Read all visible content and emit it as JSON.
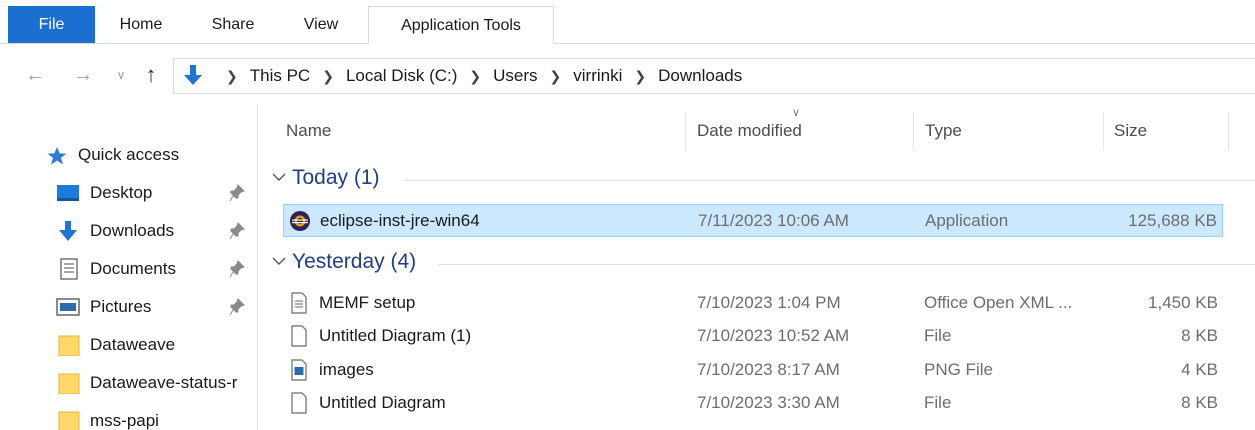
{
  "ribbon": {
    "tabs": [
      {
        "label": "File"
      },
      {
        "label": "Home"
      },
      {
        "label": "Share"
      },
      {
        "label": "View"
      },
      {
        "label": "Application Tools"
      }
    ],
    "file_tab_color": "#1a6fd0"
  },
  "address": {
    "icon": "download-arrow-icon",
    "crumbs": [
      "This PC",
      "Local Disk (C:)",
      "Users",
      "virrinki",
      "Downloads"
    ]
  },
  "navpane": {
    "quick_access": "Quick access",
    "items": [
      {
        "label": "Desktop",
        "icon": "desktop-icon",
        "pinned": true
      },
      {
        "label": "Downloads",
        "icon": "download-icon",
        "pinned": true
      },
      {
        "label": "Documents",
        "icon": "documents-icon",
        "pinned": true
      },
      {
        "label": "Pictures",
        "icon": "pictures-icon",
        "pinned": true
      },
      {
        "label": "Dataweave",
        "icon": "folder-icon",
        "pinned": false
      },
      {
        "label": "Dataweave-status-r",
        "icon": "folder-icon",
        "pinned": false
      },
      {
        "label": "mss-papi",
        "icon": "folder-icon",
        "pinned": false
      }
    ]
  },
  "columns": {
    "name": "Name",
    "date": "Date modified",
    "type": "Type",
    "size": "Size"
  },
  "groups": [
    {
      "title": "Today (1)",
      "files": [
        {
          "name": "eclipse-inst-jre-win64",
          "date": "7/11/2023 10:06 AM",
          "type": "Application",
          "size": "125,688 KB",
          "icon": "eclipse-app-icon",
          "selected": true
        }
      ]
    },
    {
      "title": "Yesterday (4)",
      "files": [
        {
          "name": "MEMF setup",
          "date": "7/10/2023 1:04 PM",
          "type": "Office Open XML ...",
          "size": "1,450 KB",
          "icon": "document-icon",
          "selected": false
        },
        {
          "name": "Untitled Diagram (1)",
          "date": "7/10/2023 10:52 AM",
          "type": "File",
          "size": "8 KB",
          "icon": "blank-file-icon",
          "selected": false
        },
        {
          "name": "images",
          "date": "7/10/2023 8:17 AM",
          "type": "PNG File",
          "size": "4 KB",
          "icon": "image-file-icon",
          "selected": false
        },
        {
          "name": "Untitled Diagram",
          "date": "7/10/2023 3:30 AM",
          "type": "File",
          "size": "8 KB",
          "icon": "blank-file-icon",
          "selected": false
        }
      ]
    }
  ],
  "colors": {
    "selection_bg": "#cce8ff",
    "selection_border": "#99d1ff",
    "group_title": "#1f3f88",
    "folder_yellow": "#ffd86a"
  }
}
